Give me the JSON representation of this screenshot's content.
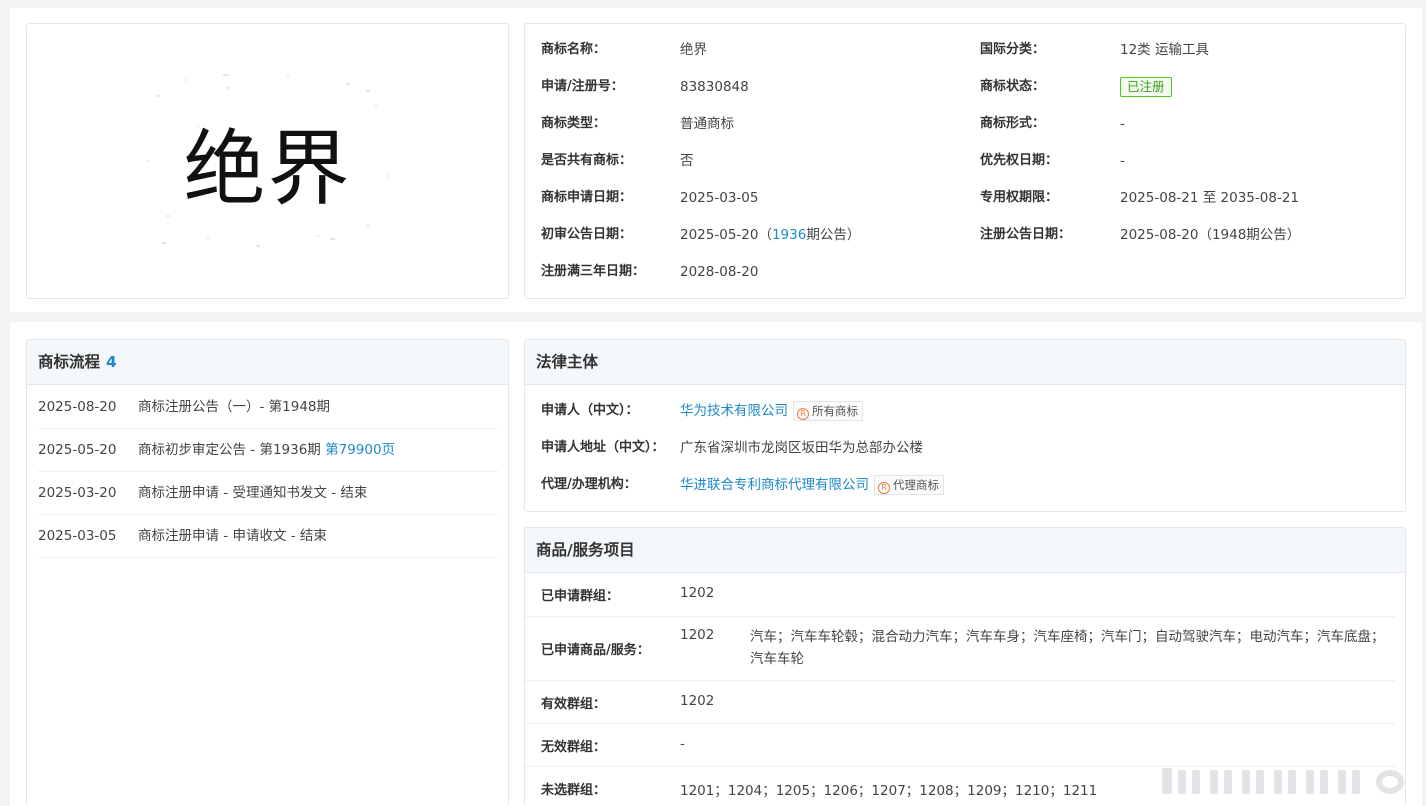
{
  "trademark": {
    "logo_text": "绝界",
    "fields": [
      {
        "label": "商标名称：",
        "value": "绝界"
      },
      {
        "label": "国际分类：",
        "value": "12类 运输工具"
      },
      {
        "label": "申请/注册号：",
        "value": "83830848"
      },
      {
        "label": "商标状态：",
        "value": "已注册"
      },
      {
        "label": "商标类型：",
        "value": "普通商标"
      },
      {
        "label": "商标形式：",
        "value": "-"
      },
      {
        "label": "是否共有商标：",
        "value": "否"
      },
      {
        "label": "优先权日期：",
        "value": "-"
      },
      {
        "label": "商标申请日期：",
        "value": "2025-03-05"
      },
      {
        "label": "专用权期限：",
        "value": "2025-08-21 至 2035-08-21"
      },
      {
        "label": "初审公告日期：",
        "value_prefix": "2025-05-20（",
        "value_link": "1936",
        "value_suffix": "期公告）"
      },
      {
        "label": "注册公告日期：",
        "value": "2025-08-20（1948期公告）"
      },
      {
        "label": "注册满三年日期：",
        "value": "2028-08-20"
      }
    ]
  },
  "flow": {
    "title": "商标流程",
    "count": "4",
    "items": [
      {
        "date": "2025-08-20",
        "text": "商标注册公告（一）- 第1948期",
        "link": ""
      },
      {
        "date": "2025-05-20",
        "text": "商标初步审定公告 - 第1936期",
        "link": "第79900页"
      },
      {
        "date": "2025-03-20",
        "text": "商标注册申请 - 受理通知书发文 - 结束",
        "link": ""
      },
      {
        "date": "2025-03-05",
        "text": "商标注册申请 - 申请收文 - 结束",
        "link": ""
      }
    ]
  },
  "legal": {
    "title": "法律主体",
    "applicant_label": "申请人（中文）：",
    "applicant_value": "华为技术有限公司",
    "applicant_tag_icon": "R",
    "applicant_tag": "所有商标",
    "address_label": "申请人地址（中文）：",
    "address_value": "广东省深圳市龙岗区坂田华为总部办公楼",
    "agent_label": "代理/办理机构：",
    "agent_value": "华进联合专利商标代理有限公司",
    "agent_tag_icon": "R",
    "agent_tag": "代理商标"
  },
  "goods": {
    "title": "商品/服务项目",
    "applied_group_label": "已申请群组：",
    "applied_group_value": "1202",
    "applied_goods_label": "已申请商品/服务：",
    "applied_goods_group": "1202",
    "applied_goods_desc": "汽车；汽车车轮毂；混合动力汽车；汽车车身；汽车座椅；汽车门；自动驾驶汽车；电动汽车；汽车底盘；汽车车轮",
    "valid_group_label": "有效群组：",
    "valid_group_value": "1202",
    "invalid_group_label": "无效群组：",
    "invalid_group_value": "-",
    "unselected_group_label": "未选群组：",
    "unselected_group_value": "1201；1204；1205；1206；1207；1208；1209；1210；1211"
  },
  "colors": {
    "link": "#1e88c8",
    "status_green": "#52c41a",
    "header_bg": "#f4f8fb"
  }
}
